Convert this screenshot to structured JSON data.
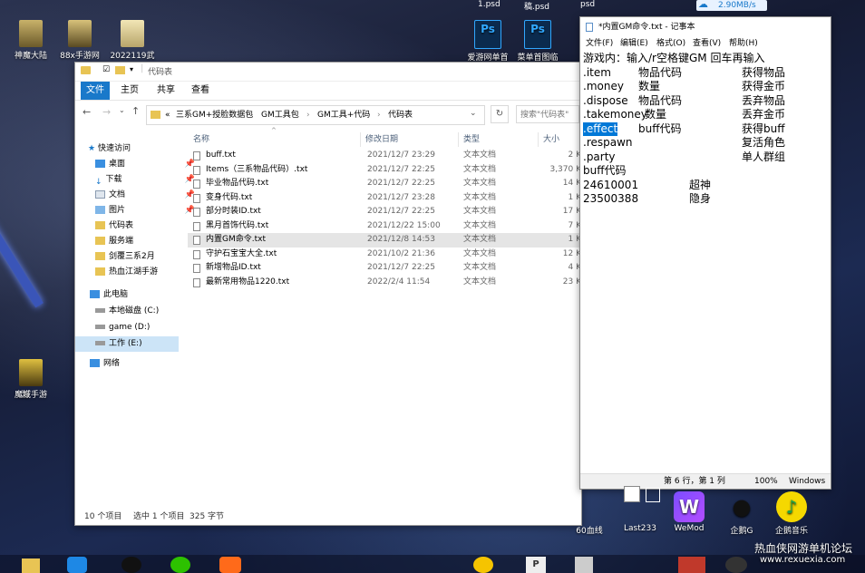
{
  "desktop": {
    "icons_left": [
      {
        "label": "神魔大陆"
      },
      {
        "label": "88x手游网"
      },
      {
        "label": "2022119武"
      }
    ],
    "icons_left_lower": [
      {
        "label": "游"
      },
      {
        "label": "魔域手游"
      }
    ],
    "top_files": [
      "1.psd",
      "稿.psd",
      "psd"
    ],
    "psd_icons": [
      {
        "label": "爱游网单首",
        "glyph": "Ps"
      },
      {
        "label": "菜单首图临",
        "glyph": "Ps"
      }
    ],
    "net_speed": "2.90MB/s",
    "apps_bottom": [
      {
        "label": "60血线"
      },
      {
        "label": "Last233"
      },
      {
        "label": "WeMod"
      },
      {
        "label": "企鹅G"
      },
      {
        "label": "企鹅音乐"
      }
    ],
    "watermark_cn": "热血侠网游单机论坛",
    "watermark_url": "www.rexuexia.com",
    "accent": "#1979ca"
  },
  "explorer": {
    "title": "代码表",
    "ribbon_tabs": [
      "文件",
      "主页",
      "共享",
      "查看"
    ],
    "breadcrumb": [
      "«",
      "三系GM+授脸数据包",
      "GM工具包",
      "GM工具+代码",
      "代码表"
    ],
    "search_placeholder": "搜索\"代码表\"",
    "nav": {
      "quick_access": "快速访问",
      "items": [
        "桌面",
        "下载",
        "文档",
        "图片",
        "代码表",
        "服务端",
        "剑覆三系2月",
        "热血江湖手游"
      ],
      "this_pc": "此电脑",
      "drives": [
        "本地磁盘 (C:)",
        "game (D:)",
        "工作 (E:)"
      ],
      "network": "网络"
    },
    "columns": {
      "name": "名称",
      "date": "修改日期",
      "type": "类型",
      "size": "大小"
    },
    "files": [
      {
        "name": "buff.txt",
        "date": "2021/12/7 23:29",
        "type": "文本文档",
        "size": "2 K"
      },
      {
        "name": "Items（三系物品代码）.txt",
        "date": "2021/12/7 22:25",
        "type": "文本文档",
        "size": "3,370 K"
      },
      {
        "name": "毕业物品代码.txt",
        "date": "2021/12/7 22:25",
        "type": "文本文档",
        "size": "14 K"
      },
      {
        "name": "变身代码.txt",
        "date": "2021/12/7 23:28",
        "type": "文本文档",
        "size": "1 K"
      },
      {
        "name": "部分时装ID.txt",
        "date": "2021/12/7 22:25",
        "type": "文本文档",
        "size": "17 K"
      },
      {
        "name": "黑月首饰代码.txt",
        "date": "2021/12/22 15:00",
        "type": "文本文档",
        "size": "7 K"
      },
      {
        "name": "内置GM命令.txt",
        "date": "2021/12/8 14:53",
        "type": "文本文档",
        "size": "1 K"
      },
      {
        "name": "守护石宝宝大全.txt",
        "date": "2021/10/2 21:36",
        "type": "文本文档",
        "size": "12 K"
      },
      {
        "name": "新增物品ID.txt",
        "date": "2021/12/7 22:25",
        "type": "文本文档",
        "size": "4 K"
      },
      {
        "name": "最新常用物品1220.txt",
        "date": "2022/2/4 11:54",
        "type": "文本文档",
        "size": "23 K"
      }
    ],
    "selected_index": 6,
    "status": {
      "count": "10 个项目",
      "selected": "选中 1 个项目",
      "size": "325 字节"
    }
  },
  "notepad": {
    "title": "*内置GM命令.txt - 记事本",
    "menu": [
      "文件(F)",
      "编辑(E)",
      "格式(O)",
      "查看(V)",
      "帮助(H)"
    ],
    "header_line": "游戏内：输入/r空格键GM 回车再输入",
    "commands": [
      {
        "cmd": ".item",
        "arg": "物品代码",
        "desc": "获得物品"
      },
      {
        "cmd": ".money",
        "arg": "数量",
        "desc": "获得金币"
      },
      {
        "cmd": ".dispose",
        "arg": "物品代码",
        "desc": "丢弃物品"
      },
      {
        "cmd": ".takemoney",
        "arg": "数量",
        "desc": "丢弃金币"
      },
      {
        "cmd": ".effect",
        "arg": "buff代码",
        "desc": "获得buff"
      },
      {
        "cmd": ".respawn",
        "arg": "",
        "desc": "复活角色"
      },
      {
        "cmd": ".party",
        "arg": "",
        "desc": "单人群组"
      }
    ],
    "buff_header": "buff代码",
    "buffs": [
      {
        "code": "24610001",
        "name": "超神"
      },
      {
        "code": "23500388",
        "name": "隐身"
      }
    ],
    "status": {
      "pos": "第 6 行，第 1 列",
      "zoom": "100%",
      "eol": "Windows ("
    }
  }
}
